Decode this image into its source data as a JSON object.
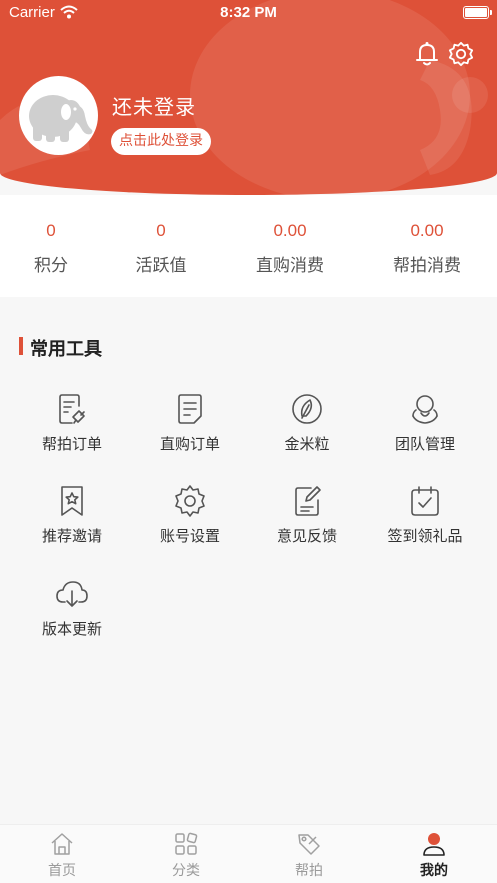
{
  "status_bar": {
    "carrier": "Carrier",
    "time": "8:32 PM"
  },
  "header": {
    "user_name": "还未登录",
    "login_label": "点击此处登录",
    "icons": [
      "bell-icon",
      "gear-icon"
    ]
  },
  "stats": [
    {
      "value": "0",
      "label": "积分"
    },
    {
      "value": "0",
      "label": "活跃值"
    },
    {
      "value": "0.00",
      "label": "直购消费"
    },
    {
      "value": "0.00",
      "label": "帮拍消费"
    }
  ],
  "tools": {
    "title": "常用工具",
    "items": [
      {
        "label": "帮拍订单",
        "icon": "bid-order-icon"
      },
      {
        "label": "直购订单",
        "icon": "order-doc-icon"
      },
      {
        "label": "金米粒",
        "icon": "leaf-coin-icon"
      },
      {
        "label": "团队管理",
        "icon": "team-icon"
      },
      {
        "label": "推荐邀请",
        "icon": "bookmark-star-icon"
      },
      {
        "label": "账号设置",
        "icon": "gear-icon"
      },
      {
        "label": "意见反馈",
        "icon": "feedback-edit-icon"
      },
      {
        "label": "签到领礼品",
        "icon": "calendar-check-icon"
      },
      {
        "label": "版本更新",
        "icon": "cloud-download-icon"
      }
    ]
  },
  "tabbar": {
    "items": [
      {
        "label": "首页",
        "icon": "home-icon"
      },
      {
        "label": "分类",
        "icon": "category-icon"
      },
      {
        "label": "帮拍",
        "icon": "tag-icon"
      },
      {
        "label": "我的",
        "icon": "profile-icon"
      }
    ],
    "active": "我的"
  },
  "colors": {
    "brand": "#de5138",
    "background": "#f7f7f7",
    "tab_inactive": "#9a9a9a",
    "tab_active": "#222222"
  }
}
